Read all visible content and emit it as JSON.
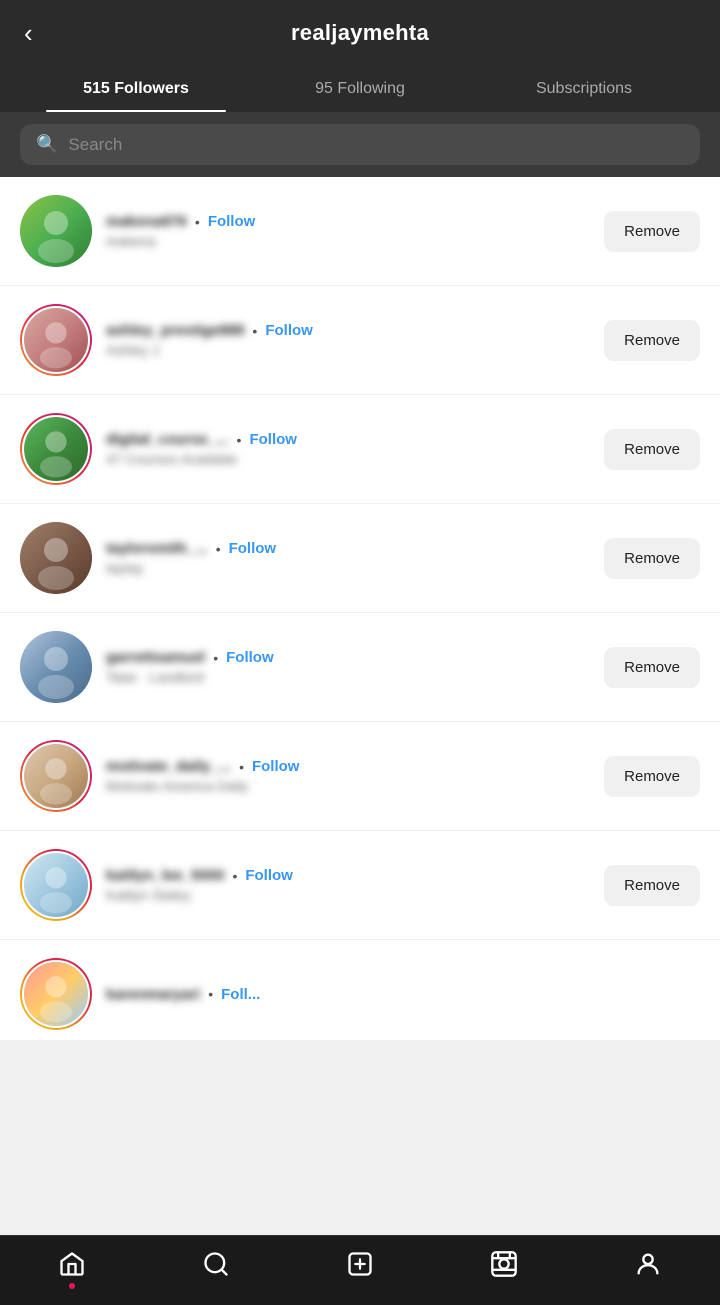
{
  "header": {
    "back_label": "‹",
    "username": "realjaymehta"
  },
  "tabs": [
    {
      "id": "followers",
      "label": "515 Followers",
      "active": true
    },
    {
      "id": "following",
      "label": "95 Following",
      "active": false
    },
    {
      "id": "subscriptions",
      "label": "Subscriptions",
      "active": false
    }
  ],
  "search": {
    "placeholder": "Search"
  },
  "followers": [
    {
      "handle": "makena976",
      "subname": "makena",
      "ring": "none",
      "avatar_class": "av-outdoor",
      "follow_label": "Follow",
      "remove_label": "Remove"
    },
    {
      "handle": "ashley_prestige888",
      "subname": "Ashley J",
      "ring": "story",
      "avatar_class": "av-woman",
      "follow_label": "Follow",
      "remove_label": "Remove"
    },
    {
      "handle": "digital_course_...",
      "subname": "47 Courses Available",
      "ring": "story",
      "avatar_class": "av-green",
      "follow_label": "Follow",
      "remove_label": "Remove"
    },
    {
      "handle": "taylorsmith_...",
      "subname": "taytay",
      "ring": "none",
      "avatar_class": "av-brunette",
      "follow_label": "Follow",
      "remove_label": "Remove"
    },
    {
      "handle": "garrettsamuel",
      "subname": "Tatar · Landlord",
      "ring": "none",
      "avatar_class": "av-group",
      "follow_label": "Follow",
      "remove_label": "Remove"
    },
    {
      "handle": "motivate_daily_...",
      "subname": "Motivate America Daily",
      "ring": "story",
      "avatar_class": "av-person",
      "follow_label": "Follow",
      "remove_label": "Remove"
    },
    {
      "handle": "kaitlyn_lee_5000",
      "subname": "Kaitlyn Staley",
      "ring": "story-yellow",
      "avatar_class": "av-hat",
      "follow_label": "Follow",
      "remove_label": "Remove"
    }
  ],
  "partial_follower": {
    "handle": "karenmaryari",
    "follow_label": "Foll...",
    "avatar_class": "av-rainbow"
  },
  "bottom_nav": [
    {
      "id": "home",
      "icon": "⌂",
      "label": "home",
      "dot": true
    },
    {
      "id": "search",
      "icon": "○",
      "label": "search",
      "dot": false
    },
    {
      "id": "add",
      "icon": "⊕",
      "label": "add",
      "dot": false
    },
    {
      "id": "reels",
      "icon": "▶",
      "label": "reels",
      "dot": false
    },
    {
      "id": "profile",
      "icon": "◉",
      "label": "profile",
      "dot": false
    }
  ]
}
